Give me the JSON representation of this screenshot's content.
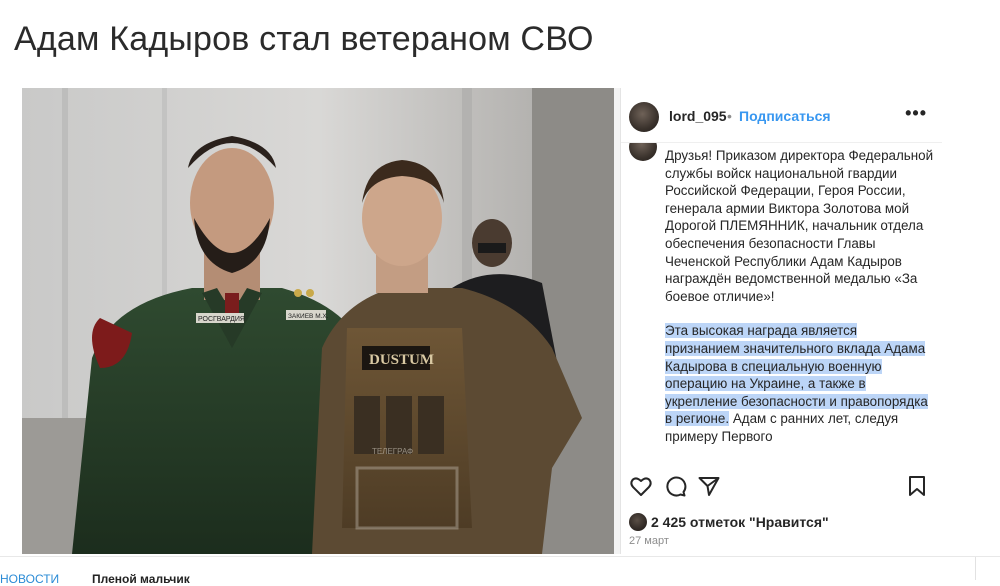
{
  "article": {
    "headline": "Адам Кадыров стал ветераном СВО"
  },
  "post": {
    "username": "lord_095",
    "separator": "•",
    "follow_label": "Подписаться",
    "more_label": "•••",
    "caption_paragraph_1": "Друзья! Приказом директора Федеральной службы войск национальной гвардии Российской Федерации, Героя России, генерала армии Виктора Золотова мой Дорогой ПЛЕМЯННИК, начальник отдела обеспечения безопасности Главы Чеченской Республики Адам Кадыров награждён ведомственной медалью «За боевое отличие»!",
    "caption_highlighted": "Эта высокая награда является признанием значительного вклада Адама Кадырова в специальную военную операцию на Украине, а также в укрепление безопасности и правопорядка в регионе.",
    "caption_rest": " Адам с ранних лет, следуя примеру Первого",
    "likes": "2 425 отметок \"Нравится\"",
    "date": "27 март",
    "icons": [
      "heart-icon",
      "comment-icon",
      "share-icon",
      "bookmark-icon"
    ]
  },
  "photo": {
    "patch_label_1": "РОСГВАРДИЯ",
    "patch_label_2": "ЗАКИЕВ М.Х.",
    "vest_label": "DUSTUM",
    "watermark": "ТЕЛЕГРАФ"
  },
  "bottom": {
    "link_text": "НОВОСТИ",
    "next_text": "Пленой мальчик"
  },
  "colors": {
    "accent": "#3897f0",
    "highlight": "#bcd5f7",
    "link": "#2a8bd6"
  }
}
